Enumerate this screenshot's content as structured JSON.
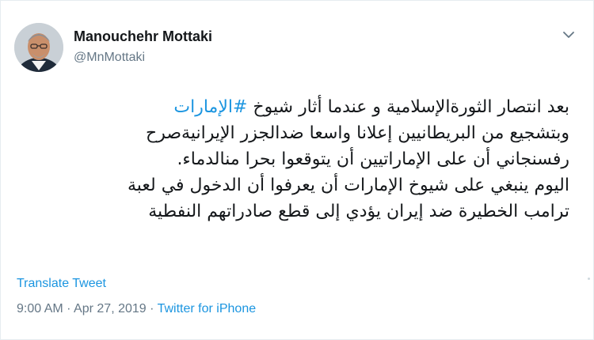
{
  "author": {
    "display_name": "Manouchehr Mottaki",
    "handle": "@MnMottaki"
  },
  "tweet": {
    "lines": [
      {
        "before": "بعد انتصار الثورةالإسلامية و عندما أثار شيوخ ",
        "hashtag": "#الإمارات"
      },
      {
        "text": "وبتشجيع من البريطانيين  إعلانا واسعا ضدالجزر الإيرانيةصرح"
      },
      {
        "text": "رفسنجاني أن على الإماراتيين أن يتوقعوا بحرا منالدماء."
      },
      {
        "text": "اليوم ينبغي على شيوخ الإمارات أن يعرفوا أن الدخول في لعبة"
      },
      {
        "text": "ترامب الخطيرة ضد إيران يؤدي إلى قطع صادراتهم النفطية"
      }
    ],
    "translate_label": "Translate Tweet",
    "time": "9:00 AM",
    "separator": " · ",
    "date": "Apr 27, 2019",
    "source": "Twitter for iPhone"
  },
  "icons": {
    "avatar": "profile-photo",
    "menu": "chevron-down-icon"
  },
  "colors": {
    "link": "#1b95e0",
    "muted": "#657786",
    "text": "#14171a"
  }
}
